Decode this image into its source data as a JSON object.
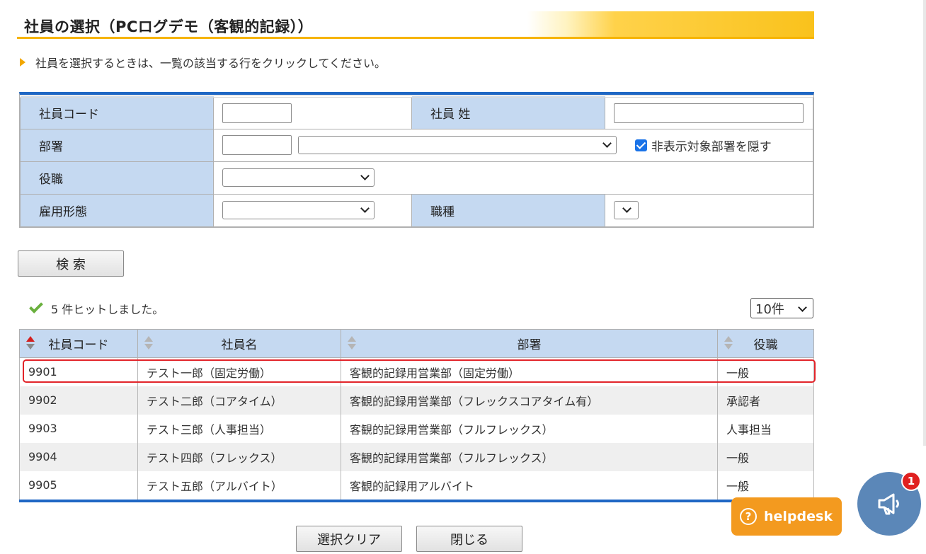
{
  "page_title": "社員の選択（PCログデモ（客観的記録））",
  "instruction": "社員を選択するときは、一覧の該当する行をクリックしてください。",
  "form": {
    "employee_code_label": "社員コード",
    "employee_code_value": "",
    "employee_surname_label": "社員 姓",
    "employee_surname_value": "",
    "department_label": "部署",
    "department_code_value": "",
    "department_select_value": "",
    "hide_hidden_depts_label": "非表示対象部署を隠す",
    "hide_hidden_depts_checked": true,
    "position_label": "役職",
    "position_value": "",
    "employment_type_label": "雇用形態",
    "employment_type_value": "",
    "job_type_label": "職種",
    "job_type_value": ""
  },
  "search_button": "検 索",
  "hit_count_text": "5 件ヒットしました。",
  "per_page": "10件",
  "results": {
    "headers": [
      "社員コード",
      "社員名",
      "部署",
      "役職"
    ],
    "rows": [
      {
        "code": "9901",
        "name": "テスト一郎（固定労働）",
        "dept": "客観的記録用営業部（固定労働）",
        "position": "一般"
      },
      {
        "code": "9902",
        "name": "テスト二郎（コアタイム）",
        "dept": "客観的記録用営業部（フレックスコアタイム有）",
        "position": "承認者"
      },
      {
        "code": "9903",
        "name": "テスト三郎（人事担当）",
        "dept": "客観的記録用営業部（フルフレックス）",
        "position": "人事担当"
      },
      {
        "code": "9904",
        "name": "テスト四郎（フレックス）",
        "dept": "客観的記録用営業部（フルフレックス）",
        "position": "一般"
      },
      {
        "code": "9905",
        "name": "テスト五郎（アルバイト）",
        "dept": "客観的記録用アルバイト",
        "position": "一般"
      }
    ]
  },
  "clear_button": "選択クリア",
  "close_button": "閉じる",
  "helpdesk_label": "helpdesk",
  "notification_count": "1",
  "colors": {
    "accent_blue": "#1f67c4",
    "label_bg": "#c5d9f1",
    "title_gold": "#f6b400",
    "helpdesk_orange": "#f39a1f",
    "announce_blue": "#5b87b8",
    "highlight_red": "#e2242a"
  }
}
